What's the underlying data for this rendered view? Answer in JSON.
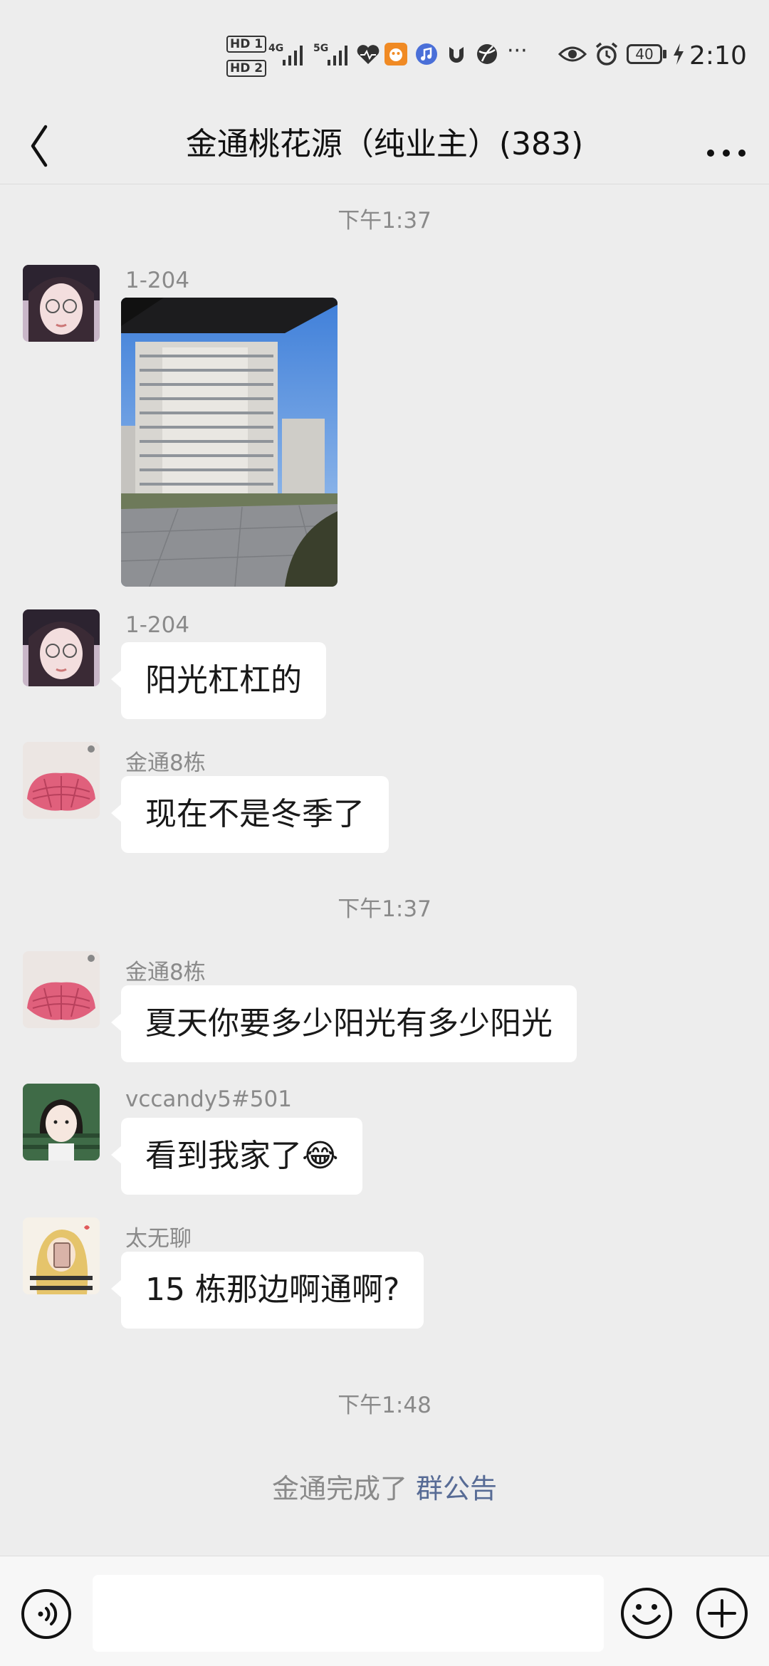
{
  "status_bar": {
    "hd1": "HD 1",
    "hd2": "HD 2",
    "net1": "4G",
    "net2": "5G",
    "battery": "40",
    "time": "2:10",
    "more": "···"
  },
  "header": {
    "title": "金通桃花源（纯业主）(383)"
  },
  "messages": [
    {
      "type": "time",
      "text": "下午1:37"
    },
    {
      "type": "image",
      "sender": "1-204"
    },
    {
      "type": "text",
      "sender": "1-204",
      "text": "阳光杠杠的"
    },
    {
      "type": "text",
      "sender": "金通8栋",
      "text": "现在不是冬季了"
    },
    {
      "type": "time",
      "text": "下午1:37"
    },
    {
      "type": "text",
      "sender": "金通8栋",
      "text": "夏天你要多少阳光有多少阳光"
    },
    {
      "type": "text",
      "sender": "vccandy5#501",
      "text": "看到我家了",
      "emoji": "😂"
    },
    {
      "type": "text",
      "sender": "太无聊",
      "text": "15 栋那边啊通啊?"
    },
    {
      "type": "time",
      "text": "下午1:48"
    },
    {
      "type": "system",
      "text": "金通完成了",
      "link": "群公告"
    }
  ],
  "icons": {
    "back": "chevron-left-icon",
    "more": "more-dots-icon",
    "voice": "voice-icon",
    "emoji": "smiley-icon",
    "plus": "plus-icon"
  },
  "colors": {
    "background": "#ededed",
    "bubble": "#ffffff",
    "link": "#576b95",
    "meta_text": "#8a8a8a"
  }
}
